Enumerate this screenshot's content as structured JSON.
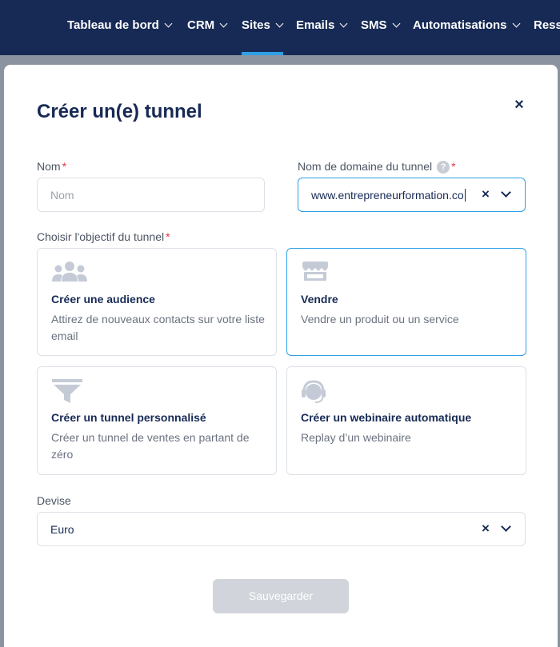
{
  "nav": {
    "items": [
      {
        "label": "Tableau de bord"
      },
      {
        "label": "CRM"
      },
      {
        "label": "Sites"
      },
      {
        "label": "Emails"
      },
      {
        "label": "SMS"
      },
      {
        "label": "Automatisations"
      },
      {
        "label": "Resso"
      }
    ],
    "active_index": 2
  },
  "modal": {
    "title": "Créer un(e) tunnel",
    "close_symbol": "×",
    "name_field": {
      "label": "Nom",
      "required_mark": "*",
      "placeholder": "Nom",
      "value": ""
    },
    "domain_field": {
      "label": "Nom de domaine du tunnel",
      "help_symbol": "?",
      "required_mark": "*",
      "value": "www.entrepreneurformation.co",
      "clear_symbol": "×"
    },
    "objective": {
      "label": "Choisir l'objectif du tunnel",
      "required_mark": "*",
      "options": [
        {
          "title": "Créer une audience",
          "description": "Attirez de nouveaux contacts sur votre liste email",
          "icon": "audience-icon"
        },
        {
          "title": "Vendre",
          "description": "Vendre un produit ou un service",
          "icon": "store-icon",
          "selected": true
        },
        {
          "title": "Créer un tunnel personnalisé",
          "description": "Créer un tunnel de ventes en partant de zéro",
          "icon": "funnel-icon"
        },
        {
          "title": "Créer un webinaire automatique",
          "description": "Replay d’un webinaire",
          "icon": "headset-icon"
        }
      ]
    },
    "currency_field": {
      "label": "Devise",
      "value": "Euro",
      "clear_symbol": "×"
    },
    "save_label": "Sauvegarder"
  },
  "colors": {
    "nav_bg": "#172a55",
    "accent": "#2ea0e6",
    "title": "#172a55",
    "required": "#e0354a",
    "disabled_button": "#d1d5db",
    "icon_gray": "#c5cbd6"
  }
}
